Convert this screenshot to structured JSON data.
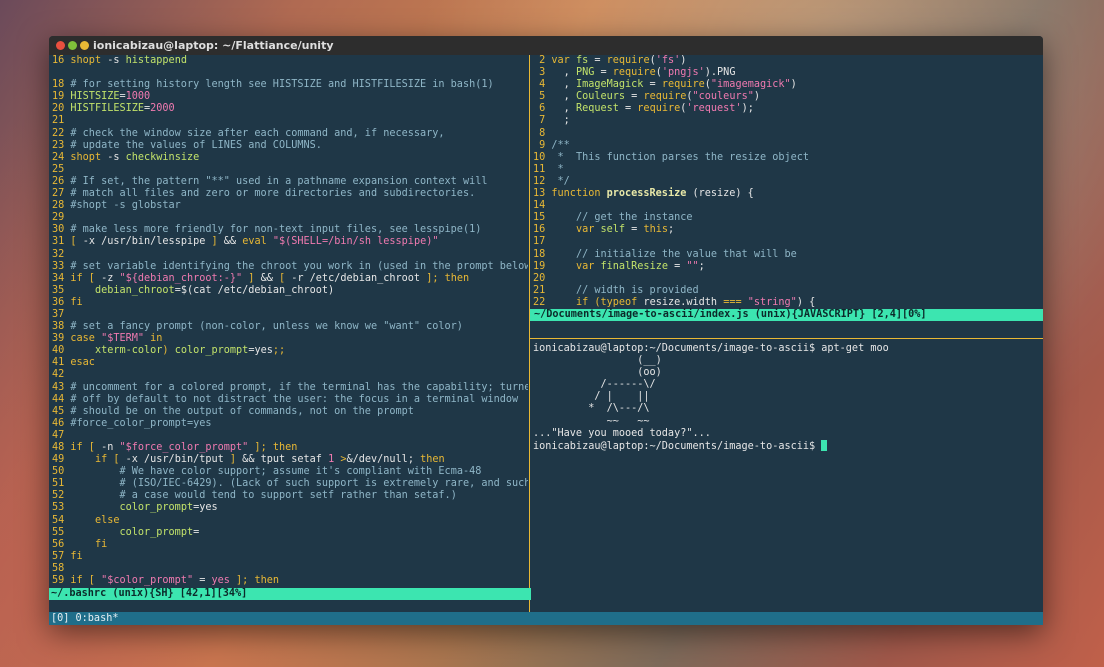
{
  "window": {
    "title": "ionicabizau@laptop: ~/Flattiance/unity"
  },
  "left_pane": {
    "lines": [
      [
        [
          "ln",
          "16 "
        ],
        [
          "kw",
          "shopt"
        ],
        [
          "tx",
          " -s "
        ],
        [
          "var",
          "histappend"
        ]
      ],
      [
        [
          "ln",
          ""
        ]
      ],
      [
        [
          "ln",
          "18 "
        ],
        [
          "cm",
          "# for setting history length see HISTSIZE and HISTFILESIZE in bash(1)"
        ]
      ],
      [
        [
          "ln",
          "19 "
        ],
        [
          "var",
          "HISTSIZE"
        ],
        [
          "tx",
          "="
        ],
        [
          "num",
          "1000"
        ]
      ],
      [
        [
          "ln",
          "20 "
        ],
        [
          "var",
          "HISTFILESIZE"
        ],
        [
          "tx",
          "="
        ],
        [
          "num",
          "2000"
        ]
      ],
      [
        [
          "ln",
          "21"
        ]
      ],
      [
        [
          "ln",
          "22 "
        ],
        [
          "cm",
          "# check the window size after each command and, if necessary,"
        ]
      ],
      [
        [
          "ln",
          "23 "
        ],
        [
          "cm",
          "# update the values of LINES and COLUMNS."
        ]
      ],
      [
        [
          "ln",
          "24 "
        ],
        [
          "kw",
          "shopt"
        ],
        [
          "tx",
          " -s "
        ],
        [
          "var",
          "checkwinsize"
        ]
      ],
      [
        [
          "ln",
          "25"
        ]
      ],
      [
        [
          "ln",
          "26 "
        ],
        [
          "cm",
          "# If set, the pattern \"**\" used in a pathname expansion context will"
        ]
      ],
      [
        [
          "ln",
          "27 "
        ],
        [
          "cm",
          "# match all files and zero or more directories and subdirectories."
        ]
      ],
      [
        [
          "ln",
          "28 "
        ],
        [
          "cm",
          "#shopt -s globstar"
        ]
      ],
      [
        [
          "ln",
          "29"
        ]
      ],
      [
        [
          "ln",
          "30 "
        ],
        [
          "cm",
          "# make less more friendly for non-text input files, see lesspipe(1)"
        ]
      ],
      [
        [
          "ln",
          "31 "
        ],
        [
          "kw",
          "[ "
        ],
        [
          "tx",
          "-x /usr/bin/lesspipe "
        ],
        [
          "kw",
          "]"
        ],
        [
          "tx",
          " && "
        ],
        [
          "kw",
          "eval"
        ],
        [
          "tx",
          " "
        ],
        [
          "str",
          "\"$(SHELL=/bin/sh lesspipe)\""
        ]
      ],
      [
        [
          "ln",
          "32"
        ]
      ],
      [
        [
          "ln",
          "33 "
        ],
        [
          "cm",
          "# set variable identifying the chroot you work in (used in the prompt below"
        ]
      ],
      [
        [
          "ln",
          "34 "
        ],
        [
          "kw",
          "if [ "
        ],
        [
          "tx",
          "-z "
        ],
        [
          "str",
          "\"${debian_chroot:-}\""
        ],
        [
          "kw",
          " ]"
        ],
        [
          "tx",
          " && "
        ],
        [
          "kw",
          "[ "
        ],
        [
          "tx",
          "-r /etc/debian_chroot "
        ],
        [
          "kw",
          "]; then"
        ]
      ],
      [
        [
          "ln",
          "35 "
        ],
        [
          "tx",
          "    "
        ],
        [
          "var",
          "debian_chroot"
        ],
        [
          "tx",
          "=$(cat /etc/debian_chroot)"
        ]
      ],
      [
        [
          "ln",
          "36 "
        ],
        [
          "kw",
          "fi"
        ]
      ],
      [
        [
          "ln",
          "37"
        ]
      ],
      [
        [
          "ln",
          "38 "
        ],
        [
          "cm",
          "# set a fancy prompt (non-color, unless we know we \"want\" color)"
        ]
      ],
      [
        [
          "ln",
          "39 "
        ],
        [
          "kw",
          "case "
        ],
        [
          "str",
          "\"$TERM\""
        ],
        [
          "kw",
          " in"
        ]
      ],
      [
        [
          "ln",
          "40 "
        ],
        [
          "tx",
          "    "
        ],
        [
          "var",
          "xterm-color"
        ],
        [
          "kw",
          ")"
        ],
        [
          "tx",
          " "
        ],
        [
          "var",
          "color_prompt"
        ],
        [
          "tx",
          "=yes"
        ],
        [
          "kw",
          ";;"
        ]
      ],
      [
        [
          "ln",
          "41 "
        ],
        [
          "kw",
          "esac"
        ]
      ],
      [
        [
          "ln",
          "42"
        ]
      ],
      [
        [
          "ln",
          "43 "
        ],
        [
          "cm",
          "# uncomment for a colored prompt, if the terminal has the capability; turne"
        ]
      ],
      [
        [
          "ln",
          "44 "
        ],
        [
          "cm",
          "# off by default to not distract the user: the focus in a terminal window"
        ]
      ],
      [
        [
          "ln",
          "45 "
        ],
        [
          "cm",
          "# should be on the output of commands, not on the prompt"
        ]
      ],
      [
        [
          "ln",
          "46 "
        ],
        [
          "cm",
          "#force_color_prompt=yes"
        ]
      ],
      [
        [
          "ln",
          "47"
        ]
      ],
      [
        [
          "ln",
          "48 "
        ],
        [
          "kw",
          "if [ "
        ],
        [
          "tx",
          "-n "
        ],
        [
          "str",
          "\"$force_color_prompt\""
        ],
        [
          "kw",
          " ]; then"
        ]
      ],
      [
        [
          "ln",
          "49 "
        ],
        [
          "tx",
          "    "
        ],
        [
          "kw",
          "if [ "
        ],
        [
          "tx",
          "-x /usr/bin/tput "
        ],
        [
          "kw",
          "]"
        ],
        [
          "tx",
          " && tput setaf "
        ],
        [
          "num",
          "1"
        ],
        [
          "tx",
          " "
        ],
        [
          "kw",
          ">"
        ],
        [
          "tx",
          "&/dev/null; "
        ],
        [
          "kw",
          "then"
        ]
      ],
      [
        [
          "ln",
          "50 "
        ],
        [
          "tx",
          "        "
        ],
        [
          "cm",
          "# We have color support; assume it's compliant with Ecma-48"
        ]
      ],
      [
        [
          "ln",
          "51 "
        ],
        [
          "tx",
          "        "
        ],
        [
          "cm",
          "# (ISO/IEC-6429). (Lack of such support is extremely rare, and such"
        ]
      ],
      [
        [
          "ln",
          "52 "
        ],
        [
          "tx",
          "        "
        ],
        [
          "cm",
          "# a case would tend to support setf rather than setaf.)"
        ]
      ],
      [
        [
          "ln",
          "53 "
        ],
        [
          "tx",
          "        "
        ],
        [
          "var",
          "color_prompt"
        ],
        [
          "tx",
          "=yes"
        ]
      ],
      [
        [
          "ln",
          "54 "
        ],
        [
          "tx",
          "    "
        ],
        [
          "kw",
          "else"
        ]
      ],
      [
        [
          "ln",
          "55 "
        ],
        [
          "tx",
          "        "
        ],
        [
          "var",
          "color_prompt"
        ],
        [
          "tx",
          "="
        ]
      ],
      [
        [
          "ln",
          "56 "
        ],
        [
          "tx",
          "    "
        ],
        [
          "kw",
          "fi"
        ]
      ],
      [
        [
          "ln",
          "57 "
        ],
        [
          "kw",
          "fi"
        ]
      ],
      [
        [
          "ln",
          "58"
        ]
      ],
      [
        [
          "ln",
          "59 "
        ],
        [
          "kw",
          "if [ "
        ],
        [
          "str",
          "\"$color_prompt\""
        ],
        [
          "tx",
          " = "
        ],
        [
          "str",
          "yes"
        ],
        [
          "kw",
          " ]; then"
        ]
      ]
    ],
    "status": "~/.bashrc (unix){SH} [42,1][34%]"
  },
  "top_right_pane": {
    "lines": [
      [
        [
          "ln",
          " 2 "
        ],
        [
          "kw",
          "var "
        ],
        [
          "var",
          "fs"
        ],
        [
          "tx",
          " = "
        ],
        [
          "kw",
          "require"
        ],
        [
          "tx",
          "("
        ],
        [
          "str",
          "'fs'"
        ],
        [
          "tx",
          ")"
        ]
      ],
      [
        [
          "ln",
          " 3 "
        ],
        [
          "tx",
          "  , "
        ],
        [
          "var",
          "PNG"
        ],
        [
          "tx",
          " = "
        ],
        [
          "kw",
          "require"
        ],
        [
          "tx",
          "("
        ],
        [
          "str",
          "'pngjs'"
        ],
        [
          "tx",
          ").PNG"
        ]
      ],
      [
        [
          "ln",
          " 4 "
        ],
        [
          "tx",
          "  , "
        ],
        [
          "var",
          "ImageMagick"
        ],
        [
          "tx",
          " = "
        ],
        [
          "kw",
          "require"
        ],
        [
          "tx",
          "("
        ],
        [
          "str",
          "\"imagemagick\""
        ],
        [
          "tx",
          ")"
        ]
      ],
      [
        [
          "ln",
          " 5 "
        ],
        [
          "tx",
          "  , "
        ],
        [
          "var",
          "Couleurs"
        ],
        [
          "tx",
          " = "
        ],
        [
          "kw",
          "require"
        ],
        [
          "tx",
          "("
        ],
        [
          "str",
          "\"couleurs\""
        ],
        [
          "tx",
          ")"
        ]
      ],
      [
        [
          "ln",
          " 6 "
        ],
        [
          "tx",
          "  , "
        ],
        [
          "var",
          "Request"
        ],
        [
          "tx",
          " = "
        ],
        [
          "kw",
          "require"
        ],
        [
          "tx",
          "("
        ],
        [
          "str",
          "'request'"
        ],
        [
          "tx",
          ");"
        ]
      ],
      [
        [
          "ln",
          " 7 "
        ],
        [
          "tx",
          "  ;"
        ]
      ],
      [
        [
          "ln",
          " 8"
        ]
      ],
      [
        [
          "ln",
          " 9 "
        ],
        [
          "cm",
          "/**"
        ]
      ],
      [
        [
          "ln",
          "10 "
        ],
        [
          "cm",
          " *  This function parses the resize object"
        ]
      ],
      [
        [
          "ln",
          "11 "
        ],
        [
          "cm",
          " *"
        ]
      ],
      [
        [
          "ln",
          "12 "
        ],
        [
          "cm",
          " */"
        ]
      ],
      [
        [
          "ln",
          "13 "
        ],
        [
          "kw",
          "function "
        ],
        [
          "fn",
          "processResize"
        ],
        [
          "tx",
          " (resize) {"
        ]
      ],
      [
        [
          "ln",
          "14"
        ]
      ],
      [
        [
          "ln",
          "15 "
        ],
        [
          "tx",
          "    "
        ],
        [
          "cm",
          "// get the instance"
        ]
      ],
      [
        [
          "ln",
          "16 "
        ],
        [
          "tx",
          "    "
        ],
        [
          "kw",
          "var "
        ],
        [
          "var",
          "self"
        ],
        [
          "tx",
          " = "
        ],
        [
          "kw",
          "this"
        ],
        [
          "tx",
          ";"
        ]
      ],
      [
        [
          "ln",
          "17"
        ]
      ],
      [
        [
          "ln",
          "18 "
        ],
        [
          "tx",
          "    "
        ],
        [
          "cm",
          "// initialize the value that will be"
        ]
      ],
      [
        [
          "ln",
          "19 "
        ],
        [
          "tx",
          "    "
        ],
        [
          "kw",
          "var "
        ],
        [
          "var",
          "finalResize"
        ],
        [
          "tx",
          " = "
        ],
        [
          "str",
          "\"\""
        ],
        [
          "tx",
          ";"
        ]
      ],
      [
        [
          "ln",
          "20"
        ]
      ],
      [
        [
          "ln",
          "21 "
        ],
        [
          "tx",
          "    "
        ],
        [
          "cm",
          "// width is provided"
        ]
      ],
      [
        [
          "ln",
          "22 "
        ],
        [
          "tx",
          "    "
        ],
        [
          "kw",
          "if ("
        ],
        [
          "kw",
          "typeof"
        ],
        [
          "tx",
          " resize.width "
        ],
        [
          "kw",
          "==="
        ],
        [
          "tx",
          " "
        ],
        [
          "str",
          "\"string\""
        ],
        [
          "tx",
          ") {"
        ]
      ]
    ],
    "status": "~/Documents/image-to-ascii/index.js (unix){JAVASCRIPT} [2,4][0%]"
  },
  "bottom_right_pane": {
    "lines": [
      "ionicabizau@laptop:~/Documents/image-to-ascii$ apt-get moo",
      "                 (__)",
      "                 (oo)",
      "           /------\\/",
      "          / |    ||",
      "         *  /\\---/\\",
      "            ~~   ~~",
      "...\"Have you mooed today?\"...",
      "ionicabizau@laptop:~/Documents/image-to-ascii$ "
    ]
  },
  "tmux": {
    "status": "[0] 0:bash*"
  },
  "colors": {
    "accent": "#3ce5b0",
    "separator": "#e8b835",
    "background": "#1f3747"
  }
}
